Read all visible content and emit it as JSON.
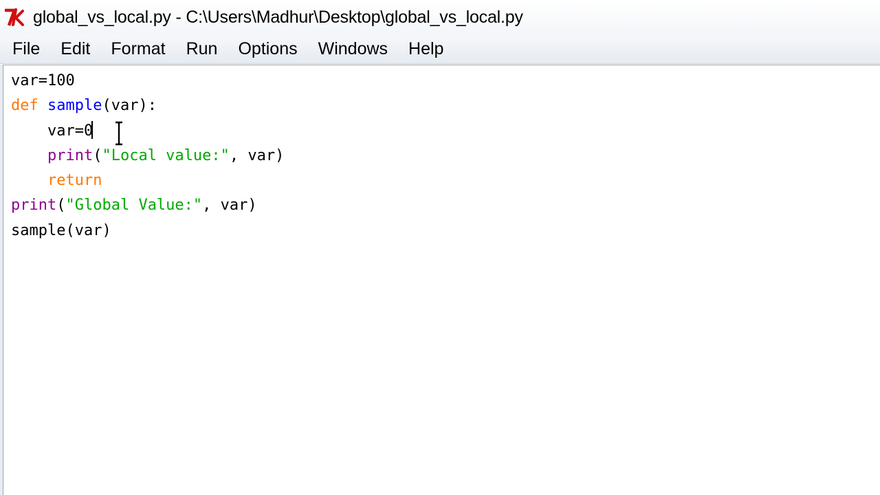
{
  "window": {
    "title": "global_vs_local.py - C:\\Users\\Madhur\\Desktop\\global_vs_local.py",
    "icon": "idle-tk-icon"
  },
  "menubar": {
    "items": [
      {
        "label": "File"
      },
      {
        "label": "Edit"
      },
      {
        "label": "Format"
      },
      {
        "label": "Run"
      },
      {
        "label": "Options"
      },
      {
        "label": "Windows"
      },
      {
        "label": "Help"
      }
    ]
  },
  "editor": {
    "lines": [
      [
        {
          "t": "var=100",
          "c": ""
        }
      ],
      [
        {
          "t": "def",
          "c": "kw"
        },
        {
          "t": " ",
          "c": ""
        },
        {
          "t": "sample",
          "c": "fn"
        },
        {
          "t": "(var):",
          "c": ""
        }
      ],
      [
        {
          "t": "    var=0",
          "c": ""
        }
      ],
      [
        {
          "t": "    ",
          "c": ""
        },
        {
          "t": "print",
          "c": "bi"
        },
        {
          "t": "(",
          "c": ""
        },
        {
          "t": "\"Local value:\"",
          "c": "st"
        },
        {
          "t": ", var)",
          "c": ""
        }
      ],
      [
        {
          "t": "    ",
          "c": ""
        },
        {
          "t": "return",
          "c": "kw"
        }
      ],
      [
        {
          "t": "print",
          "c": "bi"
        },
        {
          "t": "(",
          "c": ""
        },
        {
          "t": "\"Global Value:\"",
          "c": "st"
        },
        {
          "t": ", var)",
          "c": ""
        }
      ],
      [
        {
          "t": "sample(var)",
          "c": ""
        }
      ]
    ]
  },
  "colors": {
    "keyword": "#ff7700",
    "definition": "#0000ff",
    "builtin": "#900090",
    "string": "#00aa00"
  }
}
